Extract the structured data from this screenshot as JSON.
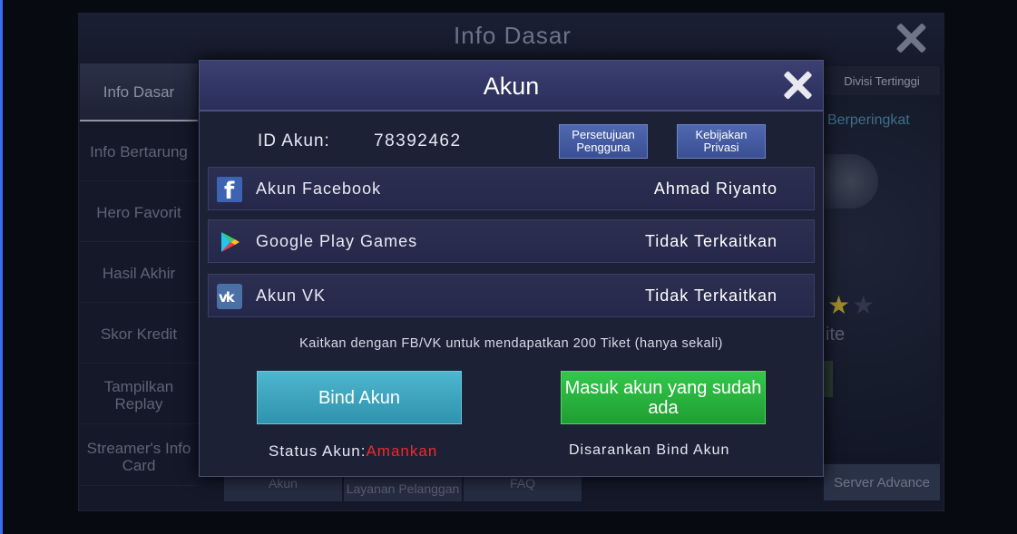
{
  "background": {
    "title": "Info Dasar",
    "sidebar": [
      {
        "label": "Info Dasar",
        "active": true
      },
      {
        "label": "Info Bertarung",
        "active": false
      },
      {
        "label": "Hero Favorit",
        "active": false
      },
      {
        "label": "Hasil Akhir",
        "active": false
      },
      {
        "label": "Skor Kredit",
        "active": false
      },
      {
        "label": "Tampilkan Replay",
        "active": false
      },
      {
        "label": "Streamer's Info Card",
        "active": false
      }
    ],
    "bottom_tabs": [
      "Akun",
      "Layanan Pelanggan",
      "FAQ"
    ],
    "right_tab": "Divisi Tertinggi",
    "right_rank_text": "Berperingkat",
    "right_partial_text": "ite",
    "right_button": "Server Advance"
  },
  "modal": {
    "title": "Akun",
    "id_label": "ID Akun:",
    "id_value": "78392462",
    "terms_button": "Persetujuan Pengguna",
    "privacy_button": "Kebijakan Privasi",
    "accounts": [
      {
        "icon": "facebook-icon",
        "name": "Akun Facebook",
        "status": "Ahmad Riyanto"
      },
      {
        "icon": "google-play-icon",
        "name": "Google Play Games",
        "status": "Tidak Terkaitkan"
      },
      {
        "icon": "vk-icon",
        "name": "Akun VK",
        "status": "Tidak Terkaitkan"
      }
    ],
    "info_text": "Kaitkan dengan FB/VK untuk mendapatkan 200 Tiket (hanya sekali)",
    "bind_button": "Bind Akun",
    "login_button": "Masuk akun yang sudah ada",
    "status_label": "Status Akun:",
    "status_value": "Amankan",
    "recommendation": "Disarankan Bind Akun"
  },
  "colors": {
    "status_value": "#ef2a2a",
    "bind_button": "#3fa6bf",
    "login_button": "#28b43e",
    "modal_header": "#33376a"
  }
}
